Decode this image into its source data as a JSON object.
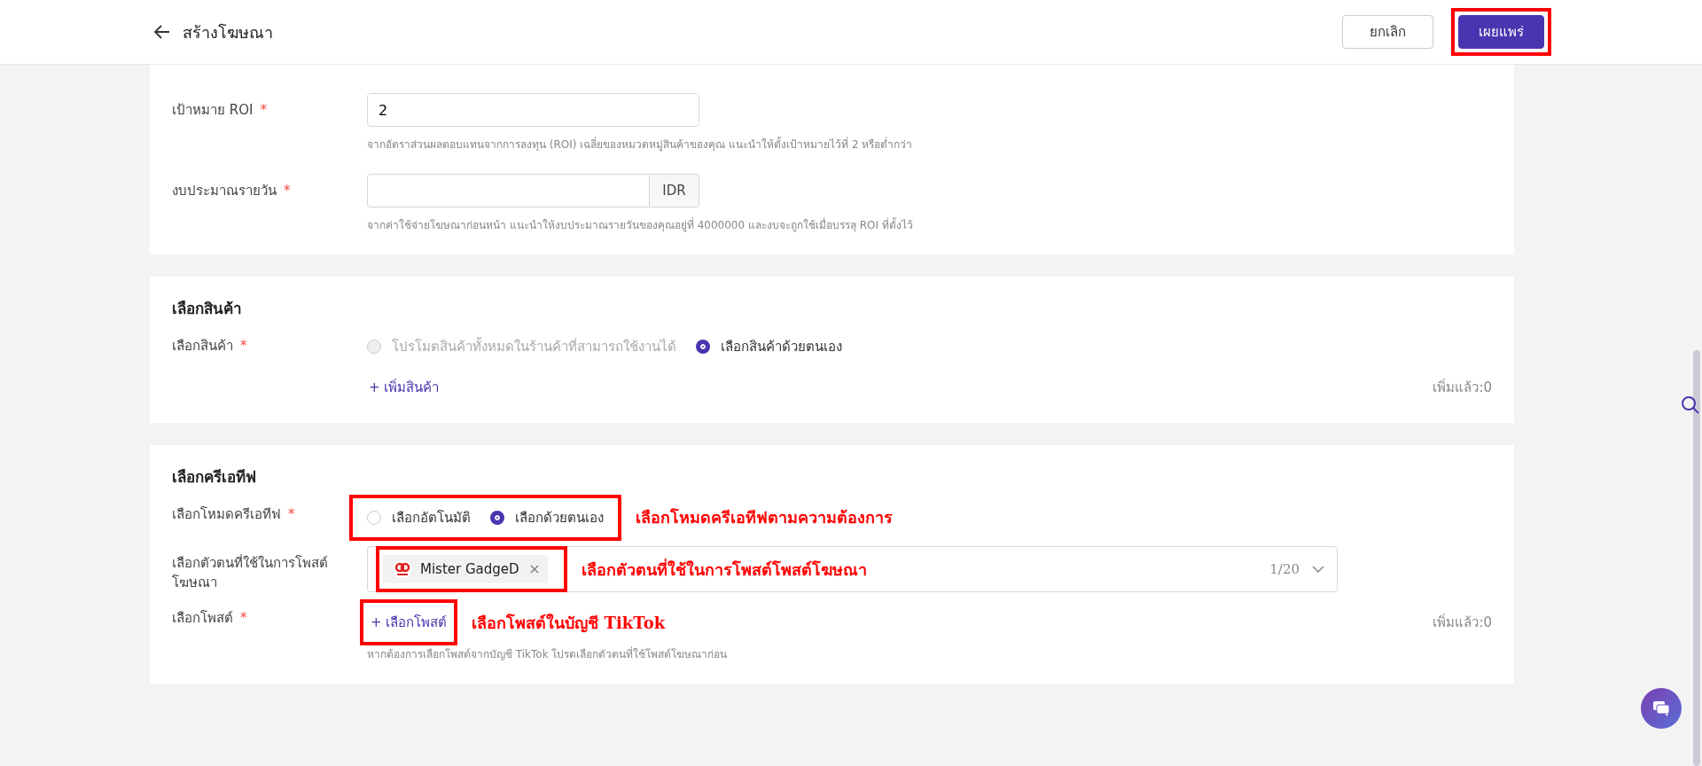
{
  "header": {
    "title": "สร้างโฆษณา",
    "buttons": [
      {
        "label": "ยกเลิก",
        "kind": "secondary",
        "highlighted": false
      },
      {
        "label": "เผยแพร่",
        "kind": "primary",
        "highlighted": true
      }
    ]
  },
  "sections": [
    {
      "fields": [
        {
          "kind": "input",
          "label": "เป้าหมาย ROI",
          "required_mark": "*",
          "value": "2",
          "hint": "จากอัตราส่วนผลตอบแทนจากการลงทุน (ROI) เฉลี่ยของหมวดหมู่สินค้าของคุณ แนะนำให้ตั้งเป้าหมายไว้ที่ 2 หรือต่ำกว่า"
        },
        {
          "kind": "input",
          "label": "งบประมาณรายวัน",
          "required_mark": "*",
          "suffix": "IDR",
          "hint": "จากค่าใช้จ่ายโฆษณาก่อนหน้า แนะนำให้งบประมาณรายวันของคุณอยู่ที่ 4000000 และงบจะถูกใช้เมื่อบรรลุ ROI ที่ตั้งไว้"
        }
      ]
    },
    {
      "title": "เลือกสินค้า",
      "fields": [
        {
          "kind": "radio",
          "label": "เลือกสินค้า",
          "required_mark": "*",
          "options": [
            {
              "label": "โปรโมตสินค้าทั้งหมดในร้านค้าที่สามารถใช้งานได้",
              "selected": false,
              "disabled": true
            },
            {
              "label": "เลือกสินค้าด้วยตนเอง",
              "selected": true,
              "disabled": false
            }
          ]
        },
        {
          "kind": "add",
          "button": "+ เพิ่มสินค้า",
          "count": "เพิ่มแล้ว:0"
        }
      ]
    },
    {
      "title": "เลือกครีเอทีฟ",
      "fields": [
        {
          "kind": "radio",
          "label": "เลือกโหมดครีเอทีฟ",
          "required_mark": "*",
          "highlighted": true,
          "annotation": "เลือกโหมดครีเอทีฟตามความต้องการ",
          "options": [
            {
              "label": "เลือกอัตโนมัติ",
              "selected": false,
              "disabled": false
            },
            {
              "label": "เลือกด้วยตนเอง",
              "selected": true,
              "disabled": false
            }
          ]
        },
        {
          "kind": "select",
          "label": "เลือกตัวตนที่ใช้ในการโพสต์โฆษณา",
          "highlighted": true,
          "tag": "Mister GadgeD",
          "annotation": "เลือกตัวตนที่ใช้ในการโพสต์โพสต์โฆษณา",
          "counter": "1/20"
        },
        {
          "kind": "add",
          "label": "เลือกโพสต์",
          "required_mark": "*",
          "button": "+ เลือกโพสต์",
          "highlighted": true,
          "annotation": "เลือกโพสต์ในบัญชี TikTok",
          "count": "เพิ่มแล้ว:0",
          "hint": "หากต้องการเลือกโพสต์จากบัญชี TikTok โปรดเลือกตัวตนที่ใช้โพสต์โฆษณาก่อน"
        }
      ]
    }
  ]
}
